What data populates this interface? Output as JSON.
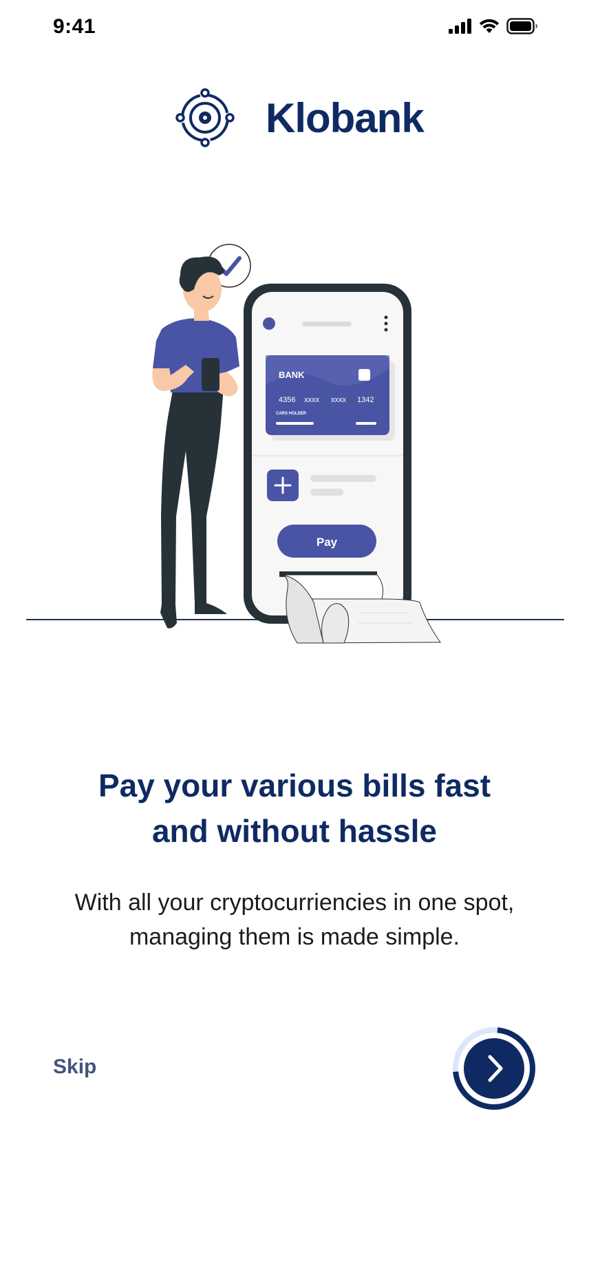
{
  "status_bar": {
    "time": "9:41"
  },
  "brand": {
    "name": "Klobank"
  },
  "illustration": {
    "card_bank_label": "BANK",
    "card_number_1": "4356",
    "card_number_2": "xxxx",
    "card_number_3": "xxxx",
    "card_number_4": "1342",
    "card_holder_label": "CARS HOLDER",
    "pay_button_label": "Pay"
  },
  "onboarding": {
    "headline_line1": "Pay your various bills fast",
    "headline_line2": "and without hassle",
    "description_line1": "With all your cryptocurriencies in one spot,",
    "description_line2": "managing them is made simple.",
    "skip_label": "Skip",
    "progress_fraction": 0.75
  },
  "colors": {
    "primary_navy": "#0f2a63",
    "accent_indigo": "#4a54a4",
    "progress_track": "#dbe6fb"
  },
  "icons": {
    "logo": "orbit-logo-icon",
    "next": "chevron-right-icon",
    "signal": "cellular-signal-icon",
    "wifi": "wifi-icon",
    "battery": "battery-icon",
    "check": "check-icon"
  }
}
